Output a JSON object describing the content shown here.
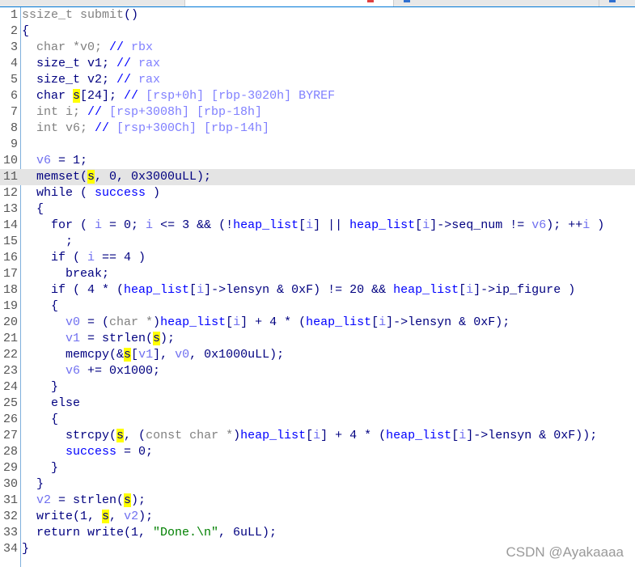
{
  "colors": {
    "default": "#000080",
    "type": "#808080",
    "local_var": "#7070f0",
    "global": "#0000ff",
    "comment": "#8080ff",
    "string": "#008000",
    "highlight": "#ffff00",
    "current_line": "#e4e4e4"
  },
  "highlighted_line": 11,
  "lines": [
    [
      [
        "t",
        "ssize_t submit"
      ],
      [
        "d",
        "()"
      ]
    ],
    [
      [
        "d",
        "{"
      ]
    ],
    [
      [
        "t",
        "  char *v0; "
      ],
      [
        "cm",
        "// "
      ],
      [
        "c",
        "rbx"
      ]
    ],
    [
      [
        "d",
        "  size_t v1; "
      ],
      [
        "cm",
        "// "
      ],
      [
        "c",
        "rax"
      ]
    ],
    [
      [
        "d",
        "  size_t v2; "
      ],
      [
        "cm",
        "// "
      ],
      [
        "c",
        "rax"
      ]
    ],
    [
      [
        "d",
        "  char "
      ],
      [
        "h",
        "s"
      ],
      [
        "d",
        "[24]; "
      ],
      [
        "cm",
        "// "
      ],
      [
        "c",
        "[rsp+0h] [rbp-3020h] BYREF"
      ]
    ],
    [
      [
        "t",
        "  int i; "
      ],
      [
        "cm",
        "// "
      ],
      [
        "c",
        "[rsp+3008h] [rbp-18h]"
      ]
    ],
    [
      [
        "t",
        "  int v6; "
      ],
      [
        "cm",
        "// "
      ],
      [
        "c",
        "[rsp+300Ch] [rbp-14h]"
      ]
    ],
    [],
    [
      [
        "v",
        "  v6"
      ],
      [
        "d",
        " = 1;"
      ]
    ],
    [
      [
        "d",
        "  memset("
      ],
      [
        "h",
        "s"
      ],
      [
        "d",
        ", 0, 0x3000uLL);"
      ]
    ],
    [
      [
        "d",
        "  while ( "
      ],
      [
        "g",
        "success"
      ],
      [
        "d",
        " )"
      ]
    ],
    [
      [
        "d",
        "  {"
      ]
    ],
    [
      [
        "d",
        "    for ( "
      ],
      [
        "v",
        "i"
      ],
      [
        "d",
        " = 0; "
      ],
      [
        "v",
        "i"
      ],
      [
        "d",
        " <= 3 && (!"
      ],
      [
        "g",
        "heap_list"
      ],
      [
        "d",
        "["
      ],
      [
        "v",
        "i"
      ],
      [
        "d",
        "] || "
      ],
      [
        "g",
        "heap_list"
      ],
      [
        "d",
        "["
      ],
      [
        "v",
        "i"
      ],
      [
        "d",
        "]->seq_num != "
      ],
      [
        "v",
        "v6"
      ],
      [
        "d",
        "); ++"
      ],
      [
        "v",
        "i"
      ],
      [
        "d",
        " )"
      ]
    ],
    [
      [
        "d",
        "      ;"
      ]
    ],
    [
      [
        "d",
        "    if ( "
      ],
      [
        "v",
        "i"
      ],
      [
        "d",
        " == 4 )"
      ]
    ],
    [
      [
        "d",
        "      break;"
      ]
    ],
    [
      [
        "d",
        "    if ( 4 * ("
      ],
      [
        "g",
        "heap_list"
      ],
      [
        "d",
        "["
      ],
      [
        "v",
        "i"
      ],
      [
        "d",
        "]->lensyn & 0xF) != 20 && "
      ],
      [
        "g",
        "heap_list"
      ],
      [
        "d",
        "["
      ],
      [
        "v",
        "i"
      ],
      [
        "d",
        "]->ip_figure )"
      ]
    ],
    [
      [
        "d",
        "    {"
      ]
    ],
    [
      [
        "v",
        "      v0"
      ],
      [
        "d",
        " = ("
      ],
      [
        "t",
        "char *"
      ],
      [
        "d",
        ")"
      ],
      [
        "g",
        "heap_list"
      ],
      [
        "d",
        "["
      ],
      [
        "v",
        "i"
      ],
      [
        "d",
        "] + 4 * ("
      ],
      [
        "g",
        "heap_list"
      ],
      [
        "d",
        "["
      ],
      [
        "v",
        "i"
      ],
      [
        "d",
        "]->lensyn & 0xF);"
      ]
    ],
    [
      [
        "v",
        "      v1"
      ],
      [
        "d",
        " = strlen("
      ],
      [
        "h",
        "s"
      ],
      [
        "d",
        ");"
      ]
    ],
    [
      [
        "d",
        "      memcpy(&"
      ],
      [
        "h",
        "s"
      ],
      [
        "d",
        "["
      ],
      [
        "v",
        "v1"
      ],
      [
        "d",
        "], "
      ],
      [
        "v",
        "v0"
      ],
      [
        "d",
        ", 0x1000uLL);"
      ]
    ],
    [
      [
        "v",
        "      v6"
      ],
      [
        "d",
        " += 0x1000;"
      ]
    ],
    [
      [
        "d",
        "    }"
      ]
    ],
    [
      [
        "d",
        "    else"
      ]
    ],
    [
      [
        "d",
        "    {"
      ]
    ],
    [
      [
        "d",
        "      strcpy("
      ],
      [
        "h",
        "s"
      ],
      [
        "d",
        ", ("
      ],
      [
        "t",
        "const char *"
      ],
      [
        "d",
        ")"
      ],
      [
        "g",
        "heap_list"
      ],
      [
        "d",
        "["
      ],
      [
        "v",
        "i"
      ],
      [
        "d",
        "] + 4 * ("
      ],
      [
        "g",
        "heap_list"
      ],
      [
        "d",
        "["
      ],
      [
        "v",
        "i"
      ],
      [
        "d",
        "]->lensyn & 0xF));"
      ]
    ],
    [
      [
        "g",
        "      success"
      ],
      [
        "d",
        " = 0;"
      ]
    ],
    [
      [
        "d",
        "    }"
      ]
    ],
    [
      [
        "d",
        "  }"
      ]
    ],
    [
      [
        "v",
        "  v2"
      ],
      [
        "d",
        " = strlen("
      ],
      [
        "h",
        "s"
      ],
      [
        "d",
        ");"
      ]
    ],
    [
      [
        "d",
        "  write(1, "
      ],
      [
        "h",
        "s"
      ],
      [
        "d",
        ", "
      ],
      [
        "v",
        "v2"
      ],
      [
        "d",
        ");"
      ]
    ],
    [
      [
        "d",
        "  return write(1, "
      ],
      [
        "str",
        "\"Done.\\n\""
      ],
      [
        "d",
        ", 6uLL);"
      ]
    ],
    [
      [
        "d",
        "}"
      ]
    ]
  ],
  "watermark": "CSDN @Ayakaaaa"
}
